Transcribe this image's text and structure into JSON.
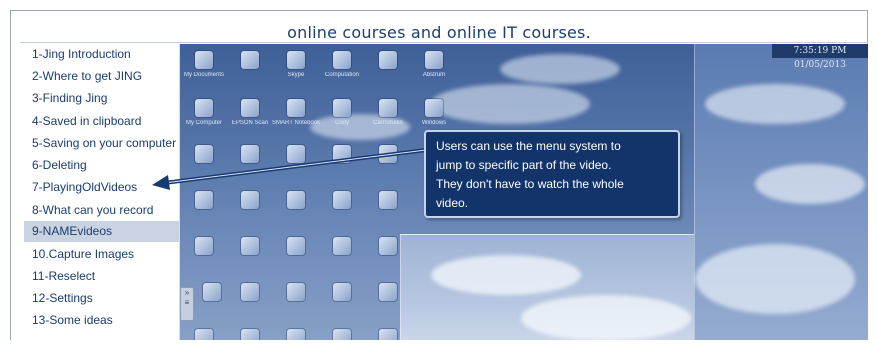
{
  "header": {
    "title": "online courses and online IT courses."
  },
  "menu": {
    "items": [
      "1-Jing Introduction",
      "2-Where to get JING",
      "3-Finding Jing",
      "4-Saved in clipboard",
      "5-Saving on your computer",
      "6-Deleting",
      "7-PlayingOldVideos",
      "8-What can you record",
      "9-NAMEvideos",
      "10.Capture Images",
      "11-Reselect",
      "12-Settings",
      "13-Some ideas"
    ],
    "selected_index": 8
  },
  "desktop": {
    "clock": "7:35:19 PM 01/05/2013",
    "icons_row1": [
      "My Documents",
      "",
      "Skype",
      "Computation",
      "",
      "Abstrum"
    ],
    "icons_row2": [
      "My Computer",
      "EPSON Scan",
      "SMART Notebook",
      "Cody",
      "CamStudio",
      "Windows"
    ]
  },
  "callout": {
    "lines": [
      "Users can use the menu system to",
      "jump to specific part of the video.",
      "They don't have to watch the whole",
      "video."
    ]
  },
  "colors": {
    "menu_text": "#1b3d6e",
    "selected_bg": "#c9d3e2",
    "callout_bg": "#12346b",
    "title_color": "#1d3f73"
  }
}
